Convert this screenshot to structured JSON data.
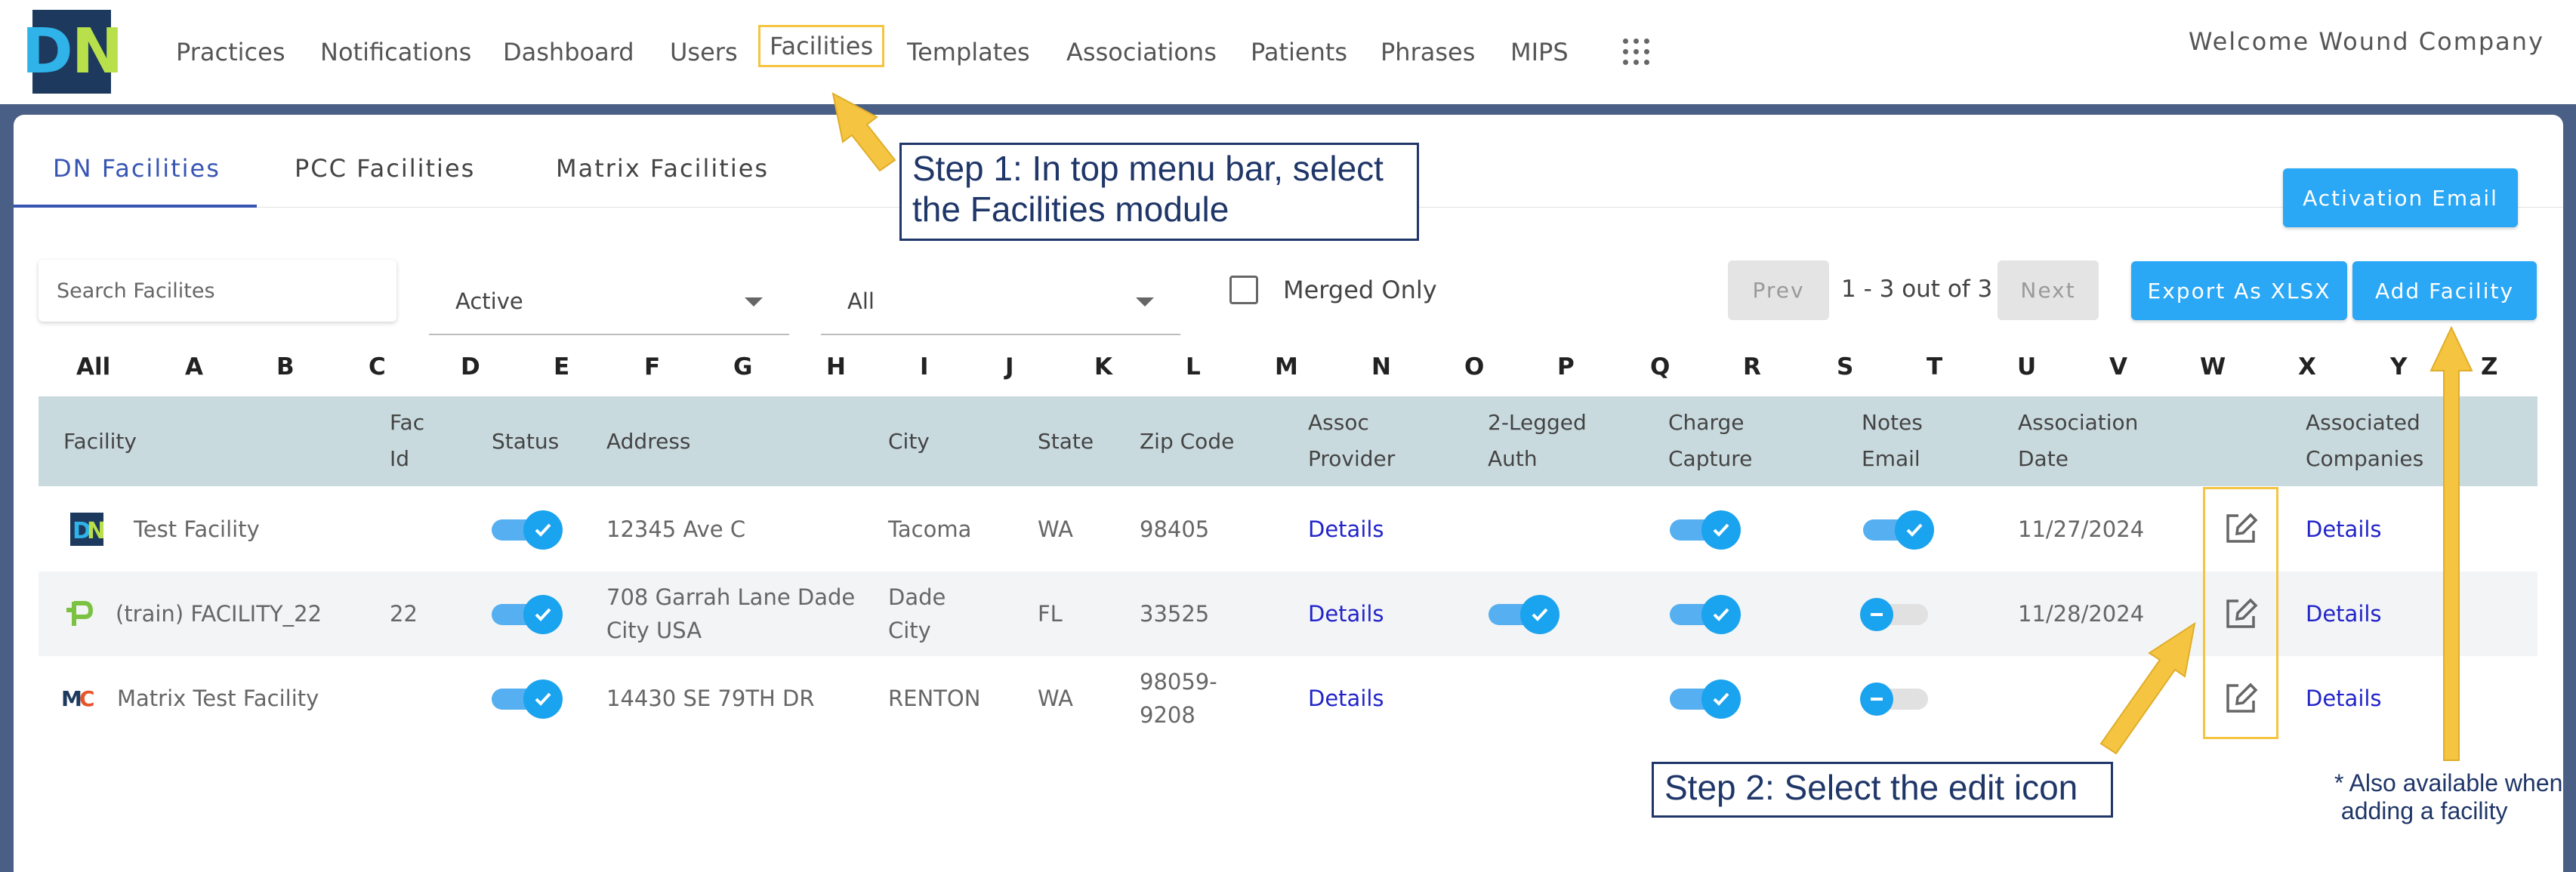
{
  "header": {
    "logo_text_d": "D",
    "logo_text_n": "N",
    "nav": [
      "Practices",
      "Notifications",
      "Dashboard",
      "Users",
      "Facilities",
      "Templates",
      "Associations",
      "Patients",
      "Phrases",
      "MIPS"
    ],
    "active_nav": "Facilities",
    "welcome": "Welcome Wound Company"
  },
  "tabs": [
    "DN Facilities",
    "PCC Facilities",
    "Matrix Facilities"
  ],
  "active_tab": "DN Facilities",
  "toolbar": {
    "search_placeholder": "Search Facilites",
    "status_filter": "Active",
    "type_filter": "All",
    "merged_only": "Merged Only",
    "prev": "Prev",
    "next": "Next",
    "page_count": "1 - 3 out of 3",
    "activation_email": "Activation Email",
    "export": "Export As XLSX",
    "add_facility": "Add Facility"
  },
  "alphabet": [
    "All",
    "A",
    "B",
    "C",
    "D",
    "E",
    "F",
    "G",
    "H",
    "I",
    "J",
    "K",
    "L",
    "M",
    "N",
    "O",
    "P",
    "Q",
    "R",
    "S",
    "T",
    "U",
    "V",
    "W",
    "X",
    "Y",
    "Z"
  ],
  "table": {
    "headers": {
      "facility": "Facility",
      "fac_id_1": "Fac",
      "fac_id_2": "Id",
      "status": "Status",
      "address": "Address",
      "city": "City",
      "state": "State",
      "zip": "Zip Code",
      "assoc_1": "Assoc",
      "assoc_2": "Provider",
      "auth_1": "2-Legged",
      "auth_2": "Auth",
      "charge_1": "Charge",
      "charge_2": "Capture",
      "notes_1": "Notes",
      "notes_2": "Email",
      "date_1": "Association",
      "date_2": "Date",
      "companies_1": "Associated",
      "companies_2": "Companies"
    },
    "rows": [
      {
        "logo": "dn",
        "name": "Test Facility",
        "fac_id": "",
        "status": true,
        "address_1": "12345 Ave C",
        "address_2": "",
        "city_1": "Tacoma",
        "city_2": "",
        "state": "WA",
        "zip_1": "98405",
        "zip_2": "",
        "assoc": "Details",
        "two_legged": null,
        "charge": true,
        "notes": "on",
        "date": "11/27/2024",
        "companies": "Details"
      },
      {
        "logo": "train",
        "name": "(train) FACILITY_22",
        "fac_id": "22",
        "status": true,
        "address_1": "708 Garrah Lane Dade",
        "address_2": "City USA",
        "city_1": "Dade",
        "city_2": "City",
        "state": "FL",
        "zip_1": "33525",
        "zip_2": "",
        "assoc": "Details",
        "two_legged": true,
        "charge": true,
        "notes": "off",
        "date": "11/28/2024",
        "companies": "Details"
      },
      {
        "logo": "mc",
        "name": "Matrix Test Facility",
        "fac_id": "",
        "status": true,
        "address_1": "14430 SE 79TH DR",
        "address_2": "",
        "city_1": "RENTON",
        "city_2": "",
        "state": "WA",
        "zip_1": "98059-",
        "zip_2": "9208",
        "assoc": "Details",
        "two_legged": null,
        "charge": true,
        "notes": "off",
        "date": "",
        "companies": "Details"
      }
    ]
  },
  "annotations": {
    "step1_line1": "Step 1: In top menu bar, select",
    "step1_line2": "the Facilities module",
    "step2": "Step 2: Select the edit icon",
    "note_line1": "* Also available when",
    "note_line2": "adding a facility"
  },
  "colors": {
    "accent": "#2aa7f5",
    "annotation": "#1f3668",
    "highlight": "#f5c542",
    "frame": "#4a5f85",
    "header_row": "#c9dadf"
  }
}
